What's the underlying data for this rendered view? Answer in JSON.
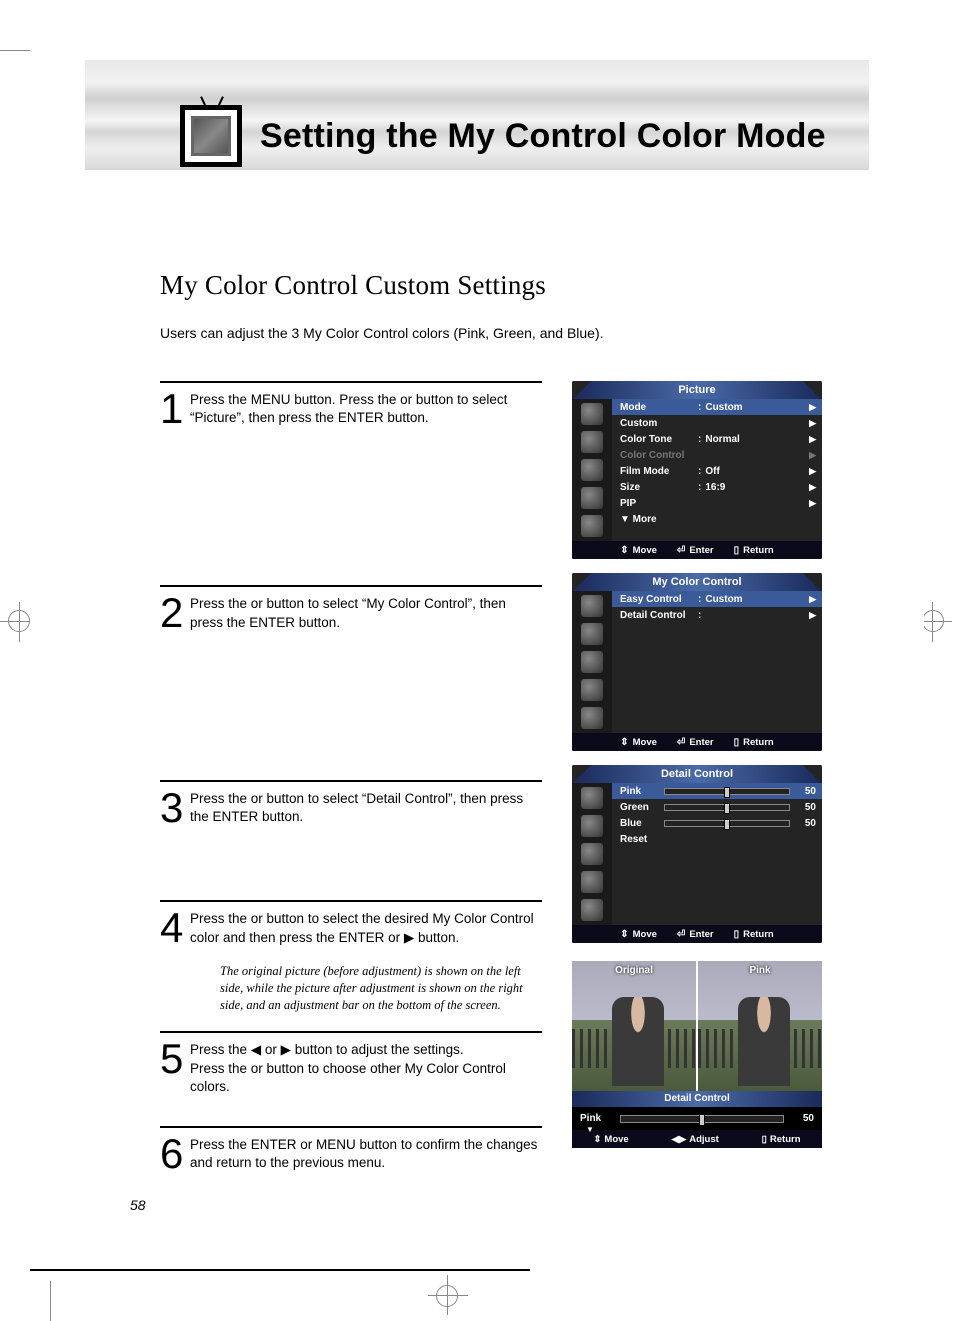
{
  "page_number": "58",
  "title": "Setting the My Control Color Mode",
  "subtitle": "My Color Control Custom Settings",
  "intro": "Users can adjust the 3 My Color Control colors (Pink, Green, and Blue).",
  "steps": [
    {
      "n": "1",
      "text": "Press the MENU button. Press the      or      button to select “Picture”, then press the ENTER button."
    },
    {
      "n": "2",
      "text": "Press the      or      button to select “My Color Control”, then press the ENTER button."
    },
    {
      "n": "3",
      "text": "Press the      or      button to select “Detail Control”, then press the ENTER button."
    },
    {
      "n": "4",
      "text": "Press the      or      button to select the desired My Color Control color and then press the ENTER or ▶ button."
    },
    {
      "n": "5",
      "text": "Press the ◀ or ▶ button to adjust the settings.\nPress the      or      button to choose other My Color Control colors."
    },
    {
      "n": "6",
      "text": "Press the ENTER or MENU button to confirm the changes and return to the previous menu."
    }
  ],
  "step4_note": "The original picture (before adjustment) is shown on the left side, while the picture after adjustment is shown on the right side, and an adjustment bar on the bottom of the screen.",
  "osd1": {
    "title": "Picture",
    "rows": [
      {
        "lbl": "Mode",
        "val": "Custom",
        "sel": true,
        "arrow": true
      },
      {
        "lbl": "Custom",
        "val": "",
        "arrow": true
      },
      {
        "lbl": "Color Tone",
        "val": "Normal",
        "arrow": true
      },
      {
        "lbl": "Color Control",
        "val": "",
        "dim": true,
        "arrow": true
      },
      {
        "lbl": "Film Mode",
        "val": "Off",
        "arrow": true
      },
      {
        "lbl": "Size",
        "val": "16:9",
        "arrow": true
      },
      {
        "lbl": "PIP",
        "val": "",
        "arrow": true
      }
    ],
    "more": "▼ More",
    "footer": {
      "move": "Move",
      "enter": "Enter",
      "return": "Return"
    }
  },
  "osd2": {
    "title": "My Color Control",
    "rows": [
      {
        "lbl": "Easy Control",
        "val": "Custom",
        "sel": true,
        "arrow": true
      },
      {
        "lbl": "Detail Control",
        "val": "",
        "arrow": true,
        "colon": true
      }
    ],
    "footer": {
      "move": "Move",
      "enter": "Enter",
      "return": "Return"
    }
  },
  "osd3": {
    "title": "Detail Control",
    "sliders": [
      {
        "lbl": "Pink",
        "val": "50",
        "sel": true
      },
      {
        "lbl": "Green",
        "val": "50"
      },
      {
        "lbl": "Blue",
        "val": "50"
      },
      {
        "lbl": "Reset",
        "val": ""
      }
    ],
    "footer": {
      "move": "Move",
      "enter": "Enter",
      "return": "Return"
    }
  },
  "preview": {
    "left_label": "Original",
    "right_label": "Pink",
    "bar_title": "Detail Control",
    "adj_label": "Pink",
    "adj_value": "50",
    "footer": {
      "move": "Move",
      "adjust": "Adjust",
      "return": "Return"
    }
  }
}
